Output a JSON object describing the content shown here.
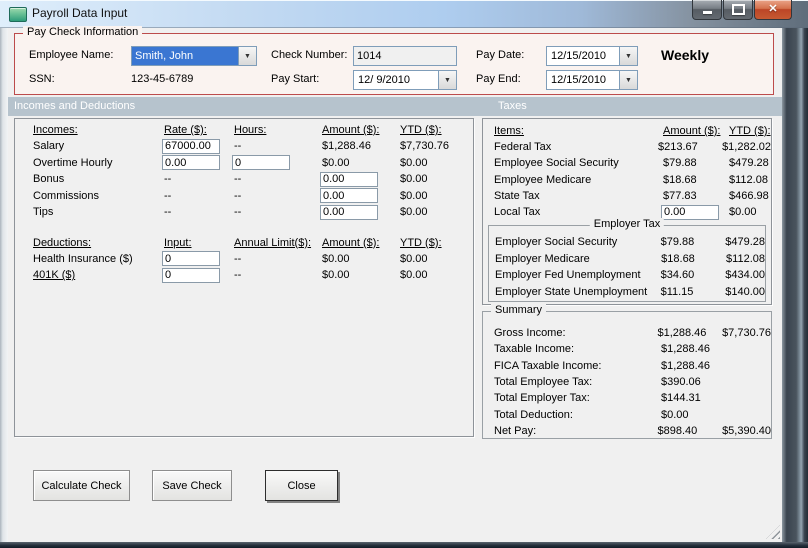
{
  "window": {
    "title": "Payroll Data Input"
  },
  "icons": {
    "dropdown_glyph": "▼",
    "close_glyph": "✕"
  },
  "paycheck": {
    "legend": "Pay Check Information",
    "employee_name_label": "Employee Name:",
    "employee_name_value": "Smith, John",
    "ssn_label": "SSN:",
    "ssn_value": "123-45-6789",
    "check_number_label": "Check Number:",
    "check_number_value": "1014",
    "pay_start_label": "Pay Start:",
    "pay_start_value": "12/ 9/2010",
    "pay_date_label": "Pay Date:",
    "pay_date_value": "12/15/2010",
    "pay_end_label": "Pay End:",
    "pay_end_value": "12/15/2010",
    "frequency": "Weekly"
  },
  "sections": {
    "left_header": "Incomes and Deductions",
    "right_header": "Taxes"
  },
  "incomes": {
    "col_headers": [
      "Incomes:",
      "Rate ($):",
      "Hours:",
      "Amount ($):",
      "YTD ($):"
    ],
    "rows": [
      {
        "label": "Salary",
        "rate": "67000.00",
        "hours": "--",
        "amount": "$1,288.46",
        "ytd": "$7,730.76"
      },
      {
        "label": "Overtime Hourly",
        "rate": "0.00",
        "hours": "0",
        "amount": "$0.00",
        "ytd": "$0.00"
      },
      {
        "label": "Bonus",
        "rate": "--",
        "hours": "--",
        "amount": "0.00",
        "ytd": "$0.00"
      },
      {
        "label": "Commissions",
        "rate": "--",
        "hours": "--",
        "amount": "0.00",
        "ytd": "$0.00"
      },
      {
        "label": "Tips",
        "rate": "--",
        "hours": "--",
        "amount": "0.00",
        "ytd": "$0.00"
      }
    ]
  },
  "deductions": {
    "col_headers": [
      "Deductions:",
      "Input:",
      "Annual Limit($):",
      "Amount ($):",
      "YTD ($):"
    ],
    "rows": [
      {
        "label": "Health Insurance  ($)",
        "input": "0",
        "annual_limit": "--",
        "amount": "$0.00",
        "ytd": "$0.00"
      },
      {
        "label": "401K  ($)",
        "input": "0",
        "annual_limit": "--",
        "amount": "$0.00",
        "ytd": "$0.00"
      }
    ]
  },
  "taxes": {
    "col_headers": [
      "Items:",
      "Amount ($):",
      "YTD ($):"
    ],
    "rows": [
      {
        "label": "Federal Tax",
        "amount": "$213.67",
        "ytd": "$1,282.02"
      },
      {
        "label": "Employee Social Security",
        "amount": "$79.88",
        "ytd": "$479.28"
      },
      {
        "label": "Employee Medicare",
        "amount": "$18.68",
        "ytd": "$112.08"
      },
      {
        "label": "State Tax",
        "amount": "$77.83",
        "ytd": "$466.98"
      },
      {
        "label": "Local Tax",
        "amount": "0.00",
        "ytd": "$0.00"
      }
    ],
    "employer": {
      "title": "Employer Tax",
      "rows": [
        {
          "label": "Employer Social Security",
          "amount": "$79.88",
          "ytd": "$479.28"
        },
        {
          "label": "Employer Medicare",
          "amount": "$18.68",
          "ytd": "$112.08"
        },
        {
          "label": "Employer Fed Unemployment",
          "amount": "$34.60",
          "ytd": "$434.00"
        },
        {
          "label": "Employer State Unemployment",
          "amount": "$11.15",
          "ytd": "$140.00"
        }
      ]
    }
  },
  "summary": {
    "title": "Summary",
    "rows": [
      {
        "label": "Gross Income:",
        "amount": "$1,288.46",
        "ytd": "$7,730.76"
      },
      {
        "label": "Taxable Income:",
        "amount": "$1,288.46",
        "ytd": ""
      },
      {
        "label": "FICA Taxable Income:",
        "amount": "$1,288.46",
        "ytd": ""
      },
      {
        "label": "Total Employee Tax:",
        "amount": "$390.06",
        "ytd": ""
      },
      {
        "label": "Total Employer Tax:",
        "amount": "$144.31",
        "ytd": ""
      },
      {
        "label": "Total Deduction:",
        "amount": "$0.00",
        "ytd": ""
      },
      {
        "label": "Net Pay:",
        "amount": "$898.40",
        "ytd": "$5,390.40"
      }
    ]
  },
  "buttons": {
    "calculate": "Calculate Check",
    "save": "Save Check",
    "close": "Close"
  },
  "colors": {
    "group_border_red": "#bc4b4b",
    "section_bar": "#b6c3cd",
    "selection_blue": "#3a76d2",
    "close_button_red": "#bc4526"
  }
}
